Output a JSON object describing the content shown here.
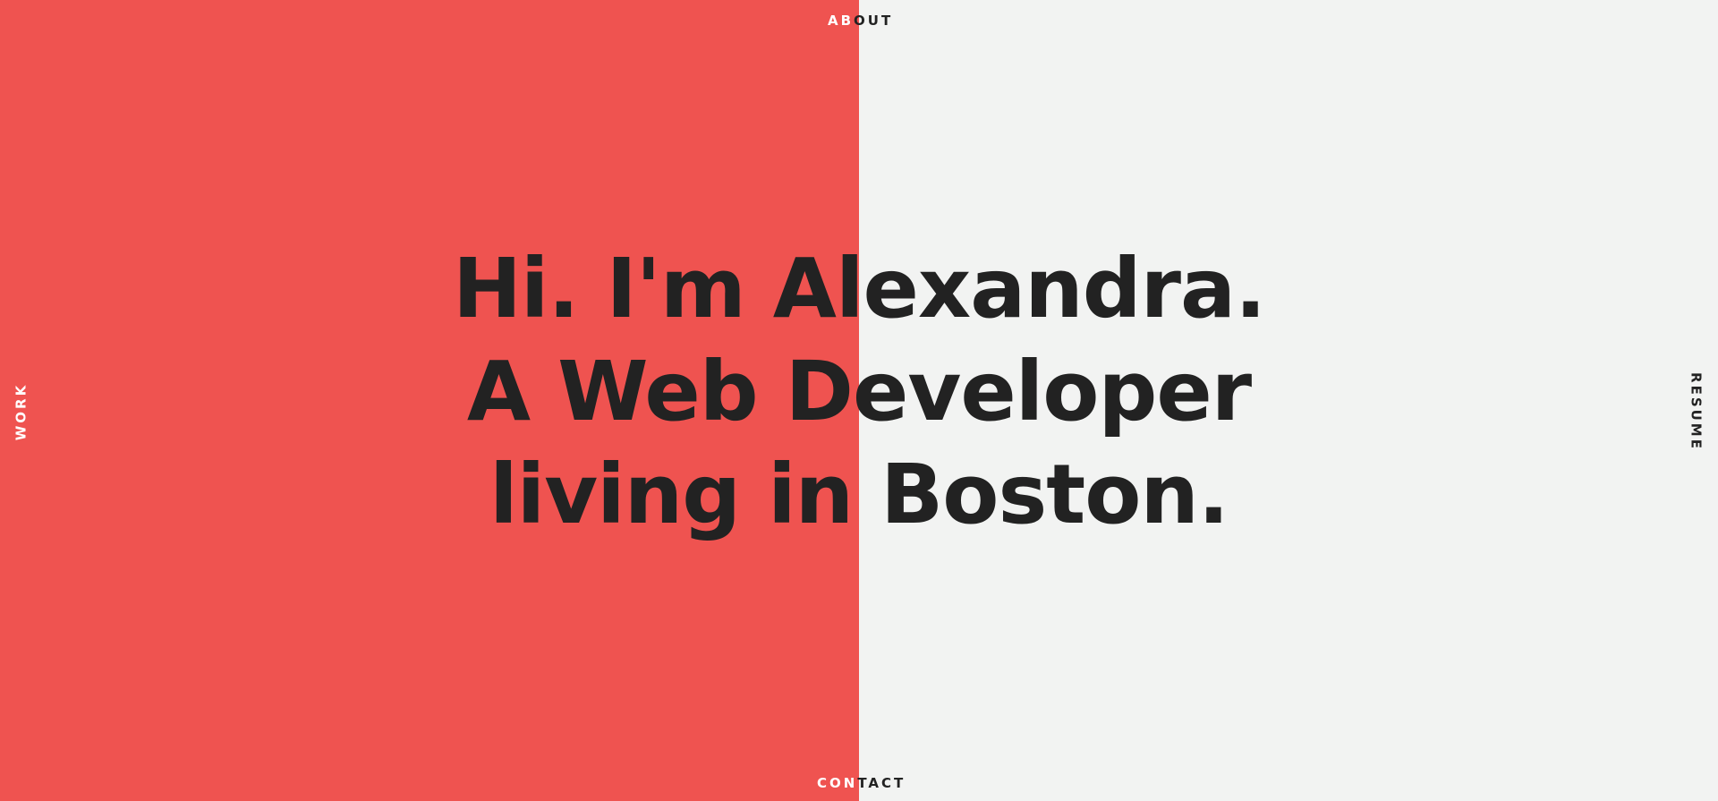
{
  "colors": {
    "left_panel": "#ef5350",
    "right_panel": "#f2f3f2",
    "text_dark": "#222222",
    "text_light": "#ffffff"
  },
  "nav": {
    "about": {
      "part_on_red": "AB",
      "part_on_light": "OUT"
    },
    "contact": {
      "part_on_red": "CON",
      "part_on_light": "TACT"
    },
    "work": "WORK",
    "resume": "RESUME"
  },
  "hero": {
    "lines": [
      "Hi. I'm Alexandra.",
      "A Web Developer",
      "living in Boston."
    ]
  }
}
